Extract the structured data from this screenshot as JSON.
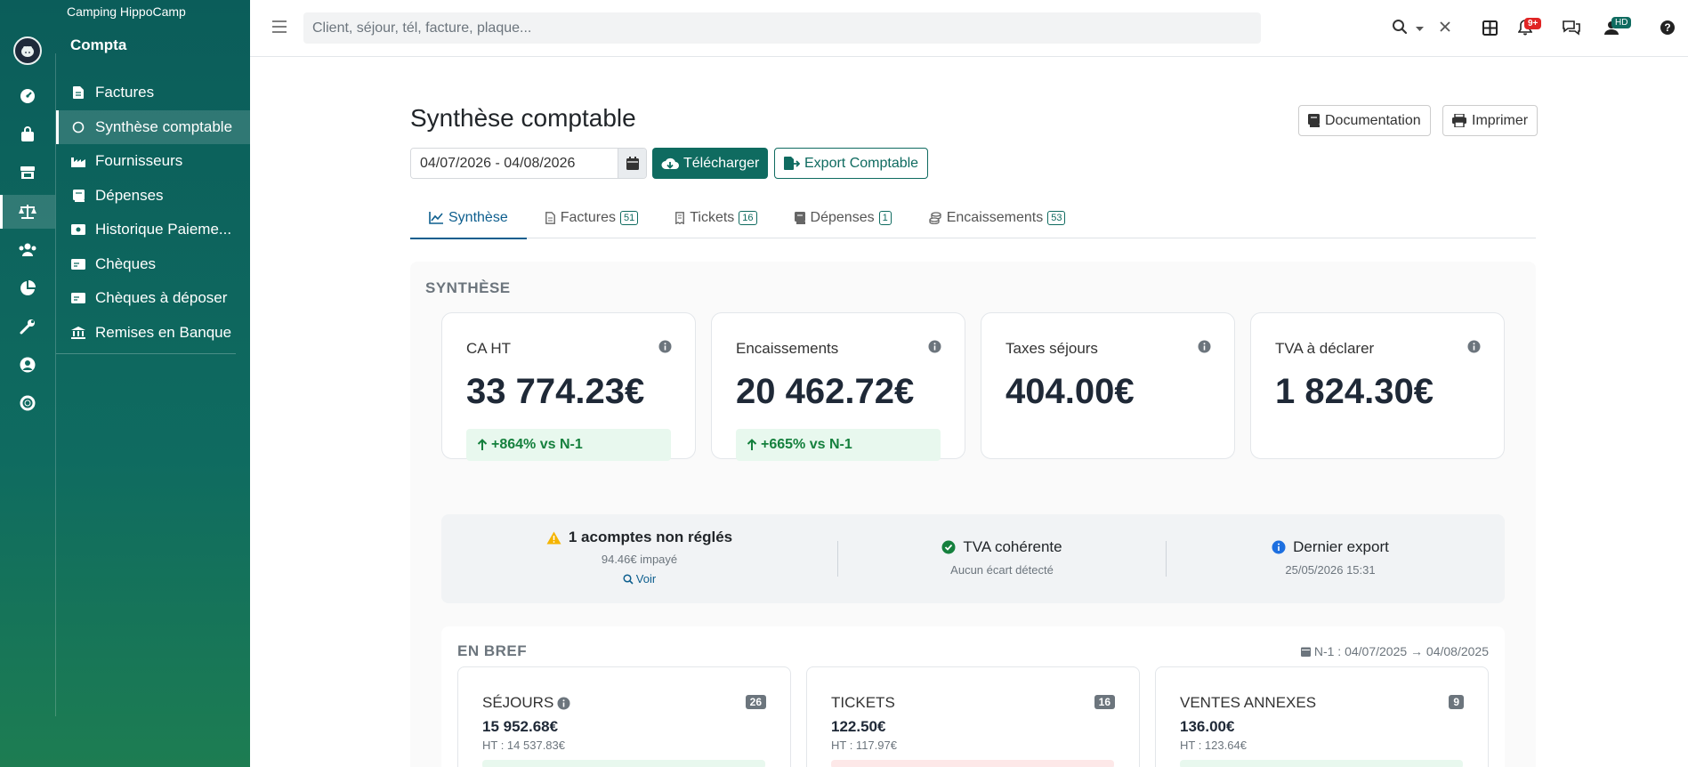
{
  "app": {
    "name": "Camping HippoCamp"
  },
  "sidebar": {
    "section_title": "Compta",
    "rail_icons": [
      "dashboard-icon",
      "shopping-bag-icon",
      "store-icon",
      "scale-icon",
      "users-icon",
      "pie-chart-icon",
      "wrench-icon",
      "user-circle-icon",
      "lifebuoy-icon"
    ],
    "items": [
      {
        "label": "Factures",
        "icon": "file-icon"
      },
      {
        "label": "Synthèse comptable",
        "icon": "circle-icon"
      },
      {
        "label": "Fournisseurs",
        "icon": "industry-icon"
      },
      {
        "label": "Dépenses",
        "icon": "book-icon"
      },
      {
        "label": "Historique Paieme...",
        "icon": "money-icon"
      },
      {
        "label": "Chèques",
        "icon": "cheque-icon"
      },
      {
        "label": "Chèques à déposer",
        "icon": "cheque-icon"
      },
      {
        "label": "Remises en Banque",
        "icon": "bank-icon"
      }
    ]
  },
  "topbar": {
    "search_placeholder": "Client, séjour, tél, facture, plaque...",
    "notifications_badge": "9+",
    "user_initials": "HD"
  },
  "page": {
    "title": "Synthèse comptable",
    "documentation_label": "Documentation",
    "print_label": "Imprimer",
    "date_range": "04/07/2026 - 04/08/2026",
    "download_label": "Télécharger",
    "export_label": "Export Comptable"
  },
  "tabs": [
    {
      "label": "Synthèse",
      "count": ""
    },
    {
      "label": "Factures",
      "count": "51"
    },
    {
      "label": "Tickets",
      "count": "16"
    },
    {
      "label": "Dépenses",
      "count": "1"
    },
    {
      "label": "Encaissements",
      "count": "53"
    }
  ],
  "synthese": {
    "title": "SYNTHÈSE",
    "kpis": [
      {
        "label": "CA HT",
        "value": "33 774.23€",
        "trend": "+864% vs N-1"
      },
      {
        "label": "Encaissements",
        "value": "20 462.72€",
        "trend": "+665% vs N-1"
      },
      {
        "label": "Taxes séjours",
        "value": "404.00€",
        "trend": ""
      },
      {
        "label": "TVA à déclarer",
        "value": "1 824.30€",
        "trend": ""
      }
    ],
    "status": {
      "acomptes": {
        "title": "1 acomptes non réglés",
        "sub": "94.46€ impayé",
        "link": "Voir"
      },
      "tva": {
        "title": "TVA cohérente",
        "sub": "Aucun écart détecté"
      },
      "export": {
        "title": "Dernier export",
        "sub": "25/05/2026 15:31"
      }
    }
  },
  "bref": {
    "title": "EN BREF",
    "period": "N-1 : 04/07/2025 → 04/08/2025",
    "cards": [
      {
        "label": "SÉJOURS",
        "count": "26",
        "value": "15 952.68€",
        "ht": "HT : 14 537.83€",
        "strip_color": "#e8f8ee"
      },
      {
        "label": "TICKETS",
        "count": "16",
        "value": "122.50€",
        "ht": "HT : 117.97€",
        "strip_color": "#fde8e8"
      },
      {
        "label": "VENTES ANNEXES",
        "count": "9",
        "value": "136.00€",
        "ht": "HT : 123.64€",
        "strip_color": "#e8f8ee"
      }
    ]
  },
  "colors": {
    "brand": "#0f6b60",
    "accent_tab": "#0d5e8e",
    "positive": "#15803d",
    "warning": "#f5b400",
    "danger": "#e02424"
  }
}
